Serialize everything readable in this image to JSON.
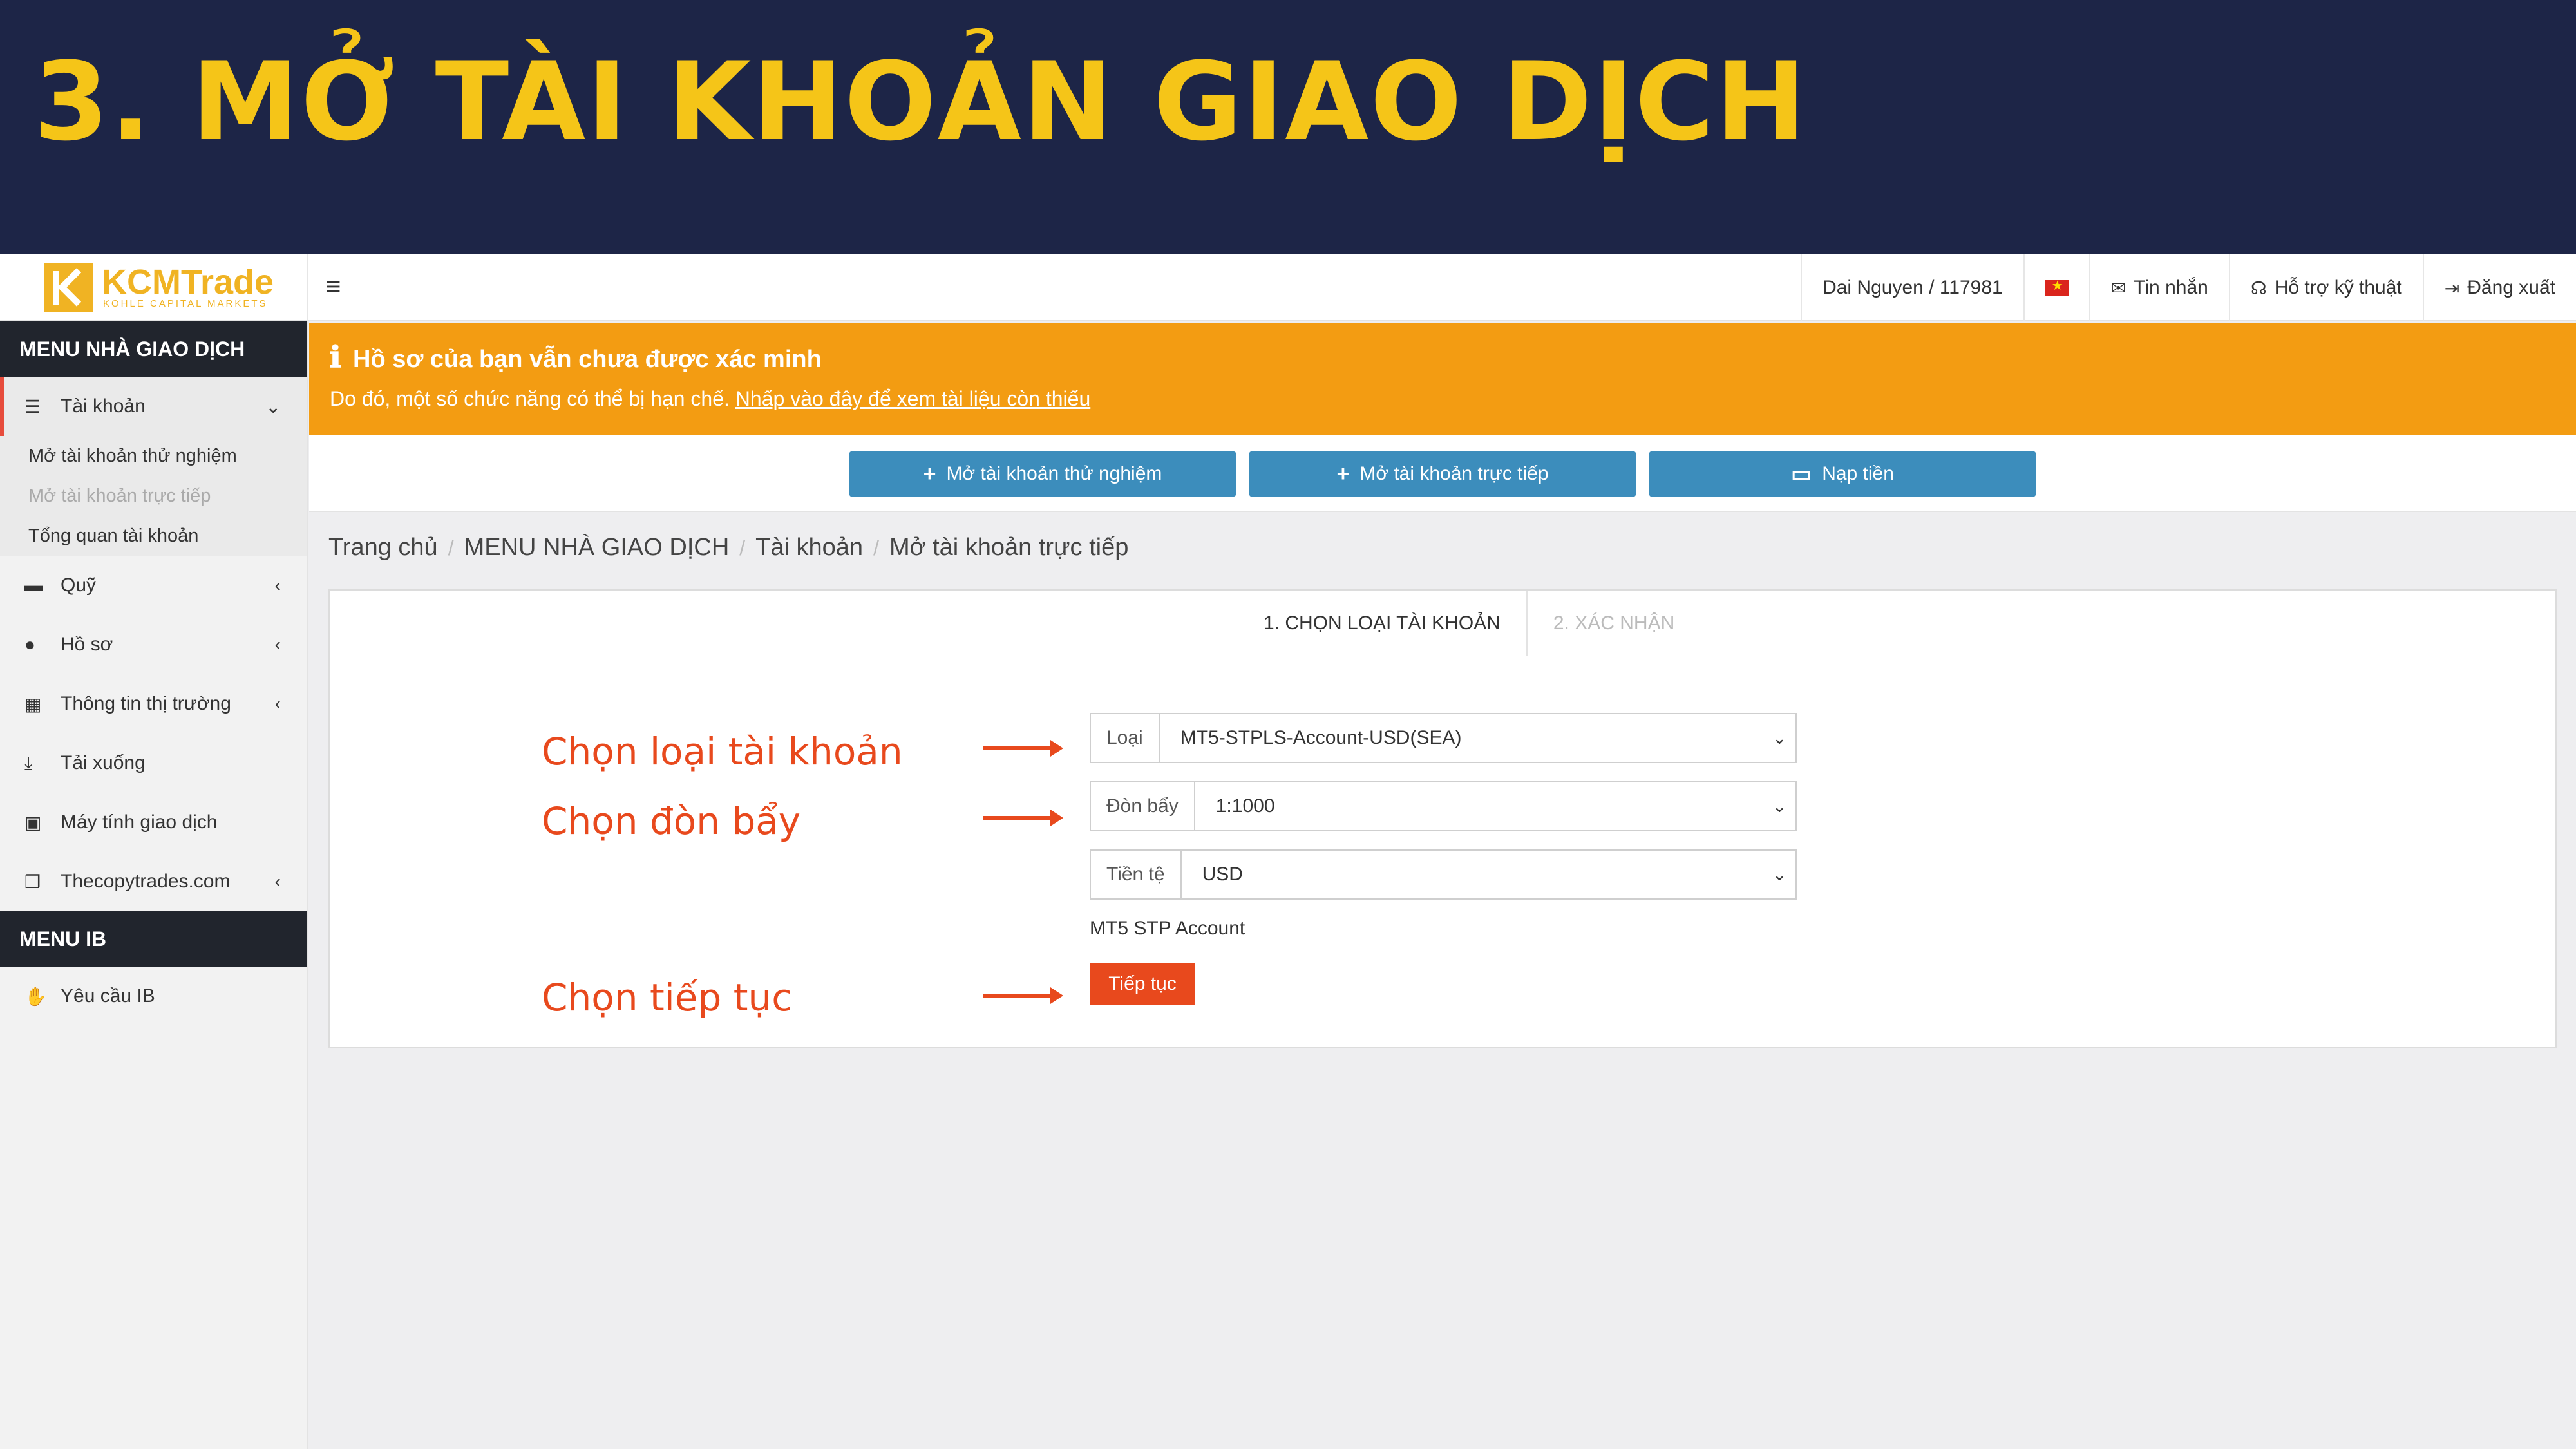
{
  "slide": {
    "title": "3. MỞ TÀI KHOẢN GIAO DỊCH"
  },
  "navbar": {
    "logo_text": "KCMTrade",
    "logo_subtext": "KOHLE CAPITAL MARKETS",
    "user": "Dai Nguyen / 117981",
    "messages": "Tin nhắn",
    "support": "Hỗ trợ kỹ thuật",
    "logout": "Đăng xuất"
  },
  "sidebar": {
    "trader_menu_title": "MENU NHÀ GIAO DỊCH",
    "items": [
      {
        "label": "Tài khoản",
        "icon": "list-icon"
      },
      {
        "label": "Quỹ",
        "icon": "wallet-icon"
      },
      {
        "label": "Hồ sơ",
        "icon": "user-icon"
      },
      {
        "label": "Thông tin thị trường",
        "icon": "calendar-icon"
      },
      {
        "label": "Tải xuống",
        "icon": "download-icon"
      },
      {
        "label": "Máy tính giao dịch",
        "icon": "calculator-icon"
      },
      {
        "label": "Thecopytrades.com",
        "icon": "copy-icon"
      }
    ],
    "account_subitems": [
      "Mở tài khoản thử nghiệm",
      "Mở tài khoản trực tiếp",
      "Tổng quan tài khoản"
    ],
    "ib_menu_title": "MENU IB",
    "ib_items": [
      {
        "label": "Yêu cầu IB",
        "icon": "handshake-icon"
      }
    ]
  },
  "alert": {
    "title": "Hồ sơ của bạn vẫn chưa được xác minh",
    "text": "Do đó, một số chức năng có thể bị hạn chế.",
    "link": "Nhấp vào đây để xem tài liệu còn thiếu"
  },
  "actions": {
    "demo": "Mở tài khoản thử nghiệm",
    "live": "Mở tài khoản trực tiếp",
    "deposit": "Nạp tiền"
  },
  "breadcrumb": [
    "Trang chủ",
    "MENU NHÀ GIAO DỊCH",
    "Tài khoản",
    "Mở tài khoản trực tiếp"
  ],
  "wizard": {
    "step1": "1. CHỌN LOẠI TÀI KHOẢN",
    "step2": "2. XÁC NHẬN",
    "fields": {
      "type_label": "Loại",
      "type_value": "MT5-STPLS-Account-USD(SEA)",
      "leverage_label": "Đòn bẩy",
      "leverage_value": "1:1000",
      "currency_label": "Tiền tệ",
      "currency_value": "USD"
    },
    "account_note": "MT5 STP Account",
    "continue": "Tiếp tục"
  },
  "annotations": {
    "choose_type": "Chọn loại tài khoản",
    "choose_leverage": "Chọn đòn bẩy",
    "choose_continue": "Chọn tiếp tục"
  },
  "colors": {
    "banner_bg": "#1d2547",
    "banner_title": "#f5c518",
    "alert_bg": "#f39c12",
    "primary_button": "#3c8dbc",
    "accent_orange": "#e8491d"
  }
}
